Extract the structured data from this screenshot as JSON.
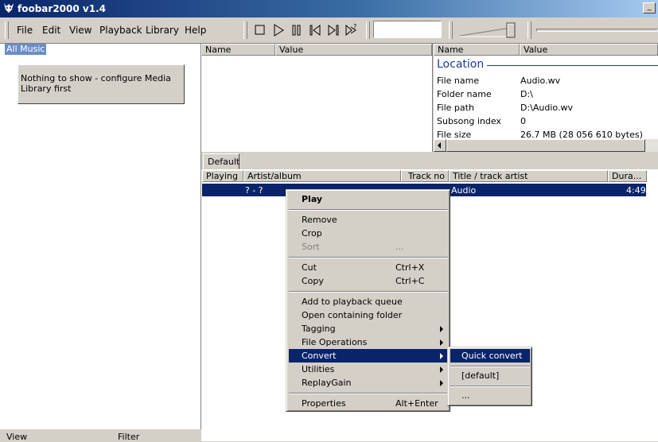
{
  "window": {
    "title": "foobar2000 v1.4"
  },
  "menu": [
    "File",
    "Edit",
    "View",
    "Playback",
    "Library",
    "Help"
  ],
  "toolbar": {
    "icons": [
      "stop-icon",
      "play-icon",
      "pause-icon",
      "previous-icon",
      "next-icon",
      "random-icon"
    ]
  },
  "library": {
    "root_label": "All Music",
    "empty_message": "Nothing to show - configure Media Library first",
    "footer_view": "View",
    "footer_filter": "Filter"
  },
  "props_left": {
    "col_name": "Name",
    "col_value": "Value"
  },
  "props_right": {
    "col_name": "Name",
    "col_value": "Value",
    "section": "Location",
    "rows": [
      {
        "name": "File name",
        "value": "Audio.wv"
      },
      {
        "name": "Folder name",
        "value": "D:\\"
      },
      {
        "name": "File path",
        "value": "D:\\Audio.wv"
      },
      {
        "name": "Subsong index",
        "value": "0"
      },
      {
        "name": "File size",
        "value": "26.7 MB (28 056 610 bytes)"
      }
    ]
  },
  "playlist": {
    "tab": "Default",
    "columns": [
      "Playing",
      "Artist/album",
      "Track no",
      "Title / track artist",
      "Dura..."
    ],
    "row": {
      "artist": "? - ?",
      "title": "Audio",
      "duration": "4:49"
    }
  },
  "context_menu": {
    "play": "Play",
    "remove": "Remove",
    "crop": "Crop",
    "sort": "Sort",
    "sort_dots": "...",
    "cut": "Cut",
    "cut_sc": "Ctrl+X",
    "copy": "Copy",
    "copy_sc": "Ctrl+C",
    "add_queue": "Add to playback queue",
    "open_folder": "Open containing folder",
    "tagging": "Tagging",
    "file_ops": "File Operations",
    "convert": "Convert",
    "utilities": "Utilities",
    "replaygain": "ReplayGain",
    "properties": "Properties",
    "properties_sc": "Alt+Enter"
  },
  "convert_submenu": {
    "quick": "Quick convert",
    "default": "[default]",
    "more": "..."
  }
}
